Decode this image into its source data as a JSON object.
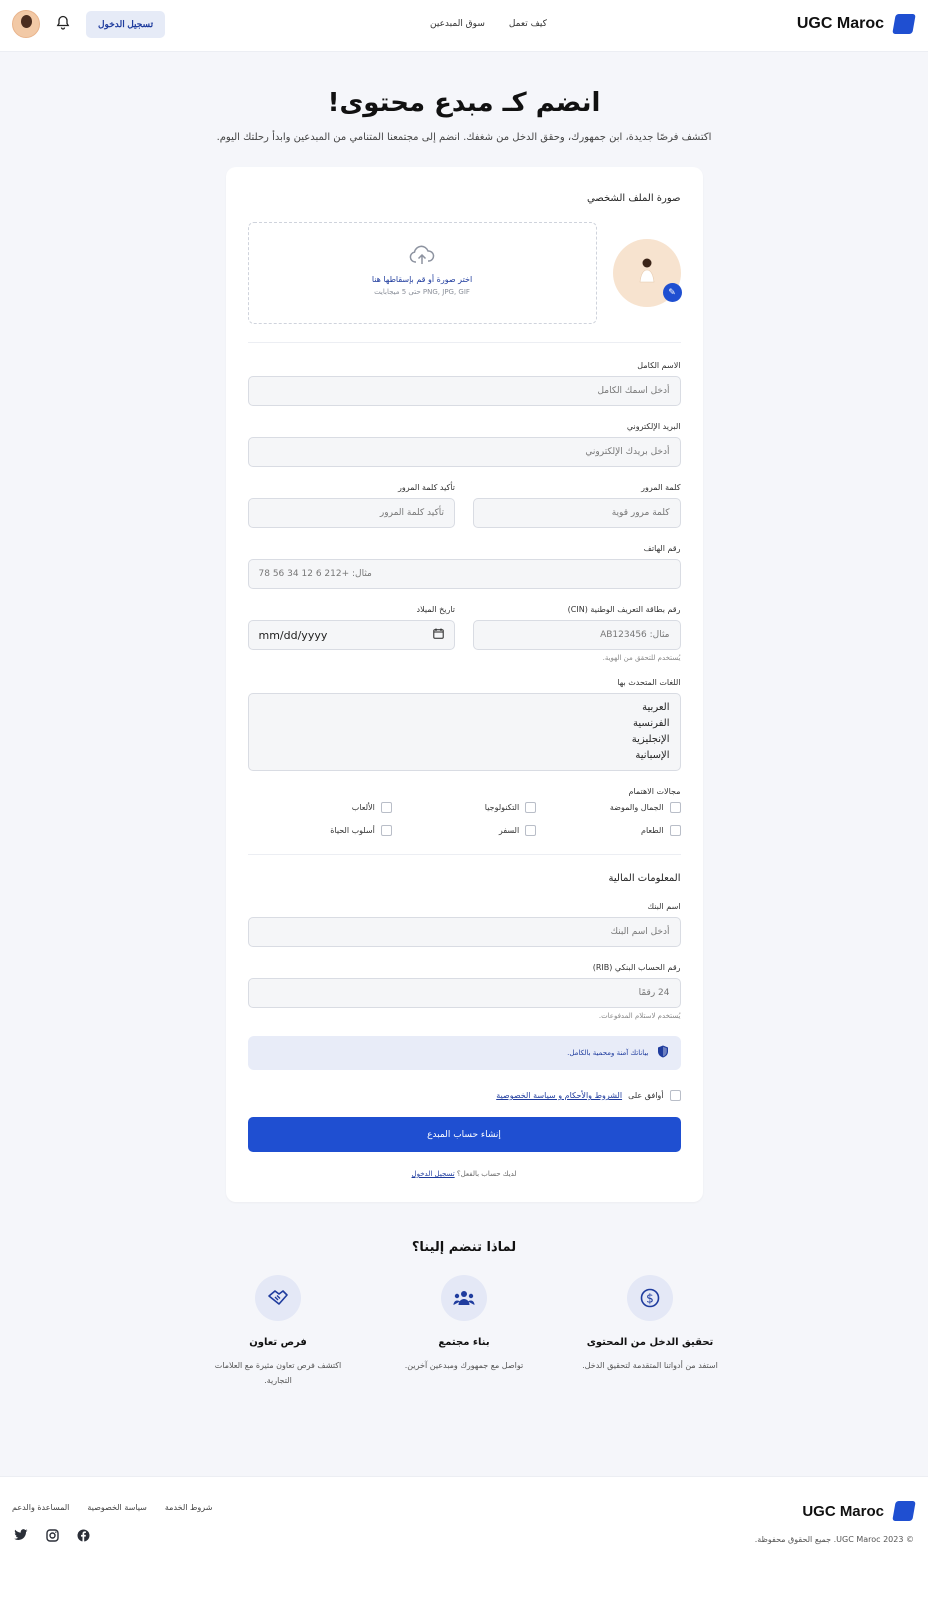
{
  "header": {
    "brand": "UGC Maroc",
    "nav": [
      "كيف تعمل",
      "سوق المبدعين"
    ],
    "login_label": "تسجيل الدخول"
  },
  "hero": {
    "title": "انضم كـ مبدع محتوى!",
    "subtitle": "اكتشف فرصًا جديدة، ابن جمهورك، وحقق الدخل من شغفك. انضم إلى مجتمعنا المتنامي من المبدعين وابدأ رحلتك اليوم."
  },
  "form": {
    "profile_photo_title": "صورة الملف الشخصي",
    "upload": {
      "choose": "اختر صورة أو قم بإسقاطها هنا",
      "hint": "PNG, JPG, GIF حتى 5 ميجابايت"
    },
    "full_name": {
      "label": "الاسم الكامل",
      "placeholder": "أدخل اسمك الكامل"
    },
    "email": {
      "label": "البريد الإلكتروني",
      "placeholder": "أدخل بريدك الإلكتروني"
    },
    "password": {
      "label": "كلمة المرور",
      "placeholder": "كلمة مرور قوية"
    },
    "confirm_password": {
      "label": "تأكيد كلمة المرور",
      "placeholder": "تأكيد كلمة المرور"
    },
    "phone": {
      "label": "رقم الهاتف",
      "placeholder": "مثال: +212 6 12 34 56 78"
    },
    "cin": {
      "label": "رقم بطاقة التعريف الوطنية (CIN)",
      "placeholder": "مثال: AB123456",
      "helper": "يُستخدم للتحقق من الهوية."
    },
    "birthdate": {
      "label": "تاريخ الميلاد",
      "value": "mm/dd/yyyy"
    },
    "languages": {
      "label": "اللغات المتحدث بها",
      "options": [
        "العربية",
        "الفرنسية",
        "الإنجليزية",
        "الإسبانية"
      ]
    },
    "interests": {
      "label": "مجالات الاهتمام",
      "options": [
        "الجمال والموضة",
        "التكنولوجيا",
        "الألعاب",
        "الطعام",
        "السفر",
        "أسلوب الحياة"
      ]
    },
    "financial_title": "المعلومات المالية",
    "bank_name": {
      "label": "اسم البنك",
      "placeholder": "أدخل اسم البنك"
    },
    "rib": {
      "label": "رقم الحساب البنكي (RIB)",
      "placeholder": "24 رقمًا",
      "helper": "يُستخدم لاستلام المدفوعات."
    },
    "secure_note": "بياناتك آمنة ومحمية بالكامل.",
    "terms_prefix": "أوافق على",
    "terms_link": "الشروط والأحكام و سياسة الخصوصية",
    "submit_label": "إنشاء حساب المبدع",
    "have_account": "لديك حساب بالفعل؟",
    "login_link": "تسجيل الدخول"
  },
  "why": {
    "title": "لماذا تنضم إلينا؟",
    "features": [
      {
        "icon": "dollar-icon",
        "title": "تحقيق الدخل من المحتوى",
        "desc": "استفد من أدواتنا المتقدمة لتحقيق الدخل."
      },
      {
        "icon": "community-icon",
        "title": "بناء مجتمع",
        "desc": "تواصل مع جمهورك ومبدعين آخرين."
      },
      {
        "icon": "handshake-icon",
        "title": "فرص تعاون",
        "desc": "اكتشف فرص تعاون مثيرة مع العلامات التجارية."
      }
    ]
  },
  "footer": {
    "brand": "UGC Maroc",
    "copyright": "© 2023 UGC Maroc. جميع الحقوق محفوظة.",
    "links": [
      "شروط الخدمة",
      "سياسة الخصوصية",
      "المساعدة والدعم"
    ]
  },
  "colors": {
    "primary": "#1f4fd1",
    "accent_bg": "#e6ebf7",
    "page_bg": "#f5f6fa"
  }
}
